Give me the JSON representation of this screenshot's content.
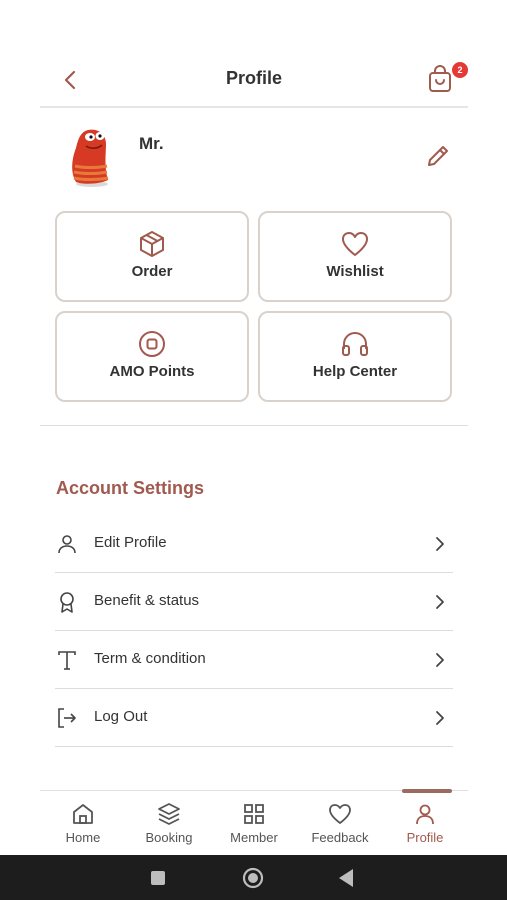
{
  "header": {
    "title": "Profile",
    "cart_badge": "2"
  },
  "profile": {
    "name": "Mr."
  },
  "cards": [
    {
      "label": "Order",
      "icon": "box-icon"
    },
    {
      "label": "Wishlist",
      "icon": "heart-icon"
    },
    {
      "label": "AMO Points",
      "icon": "points-icon"
    },
    {
      "label": "Help Center",
      "icon": "headphones-icon"
    }
  ],
  "account_settings": {
    "title": "Account Settings",
    "items": [
      {
        "label": "Edit Profile",
        "icon": "user-icon"
      },
      {
        "label": "Benefit & status",
        "icon": "ribbon-icon"
      },
      {
        "label": "Term & condition",
        "icon": "text-icon"
      },
      {
        "label": "Log Out",
        "icon": "logout-icon"
      }
    ]
  },
  "bottom_nav": {
    "items": [
      {
        "label": "Home",
        "icon": "home-icon"
      },
      {
        "label": "Booking",
        "icon": "layers-icon"
      },
      {
        "label": "Member",
        "icon": "grid-icon"
      },
      {
        "label": "Feedback",
        "icon": "heart-icon"
      },
      {
        "label": "Profile",
        "icon": "user-icon",
        "active": true
      }
    ]
  },
  "colors": {
    "accent": "#a05a4e",
    "badge": "#e53935",
    "card_border": "#d9d2cb",
    "system_bar": "#1d1d1d"
  }
}
